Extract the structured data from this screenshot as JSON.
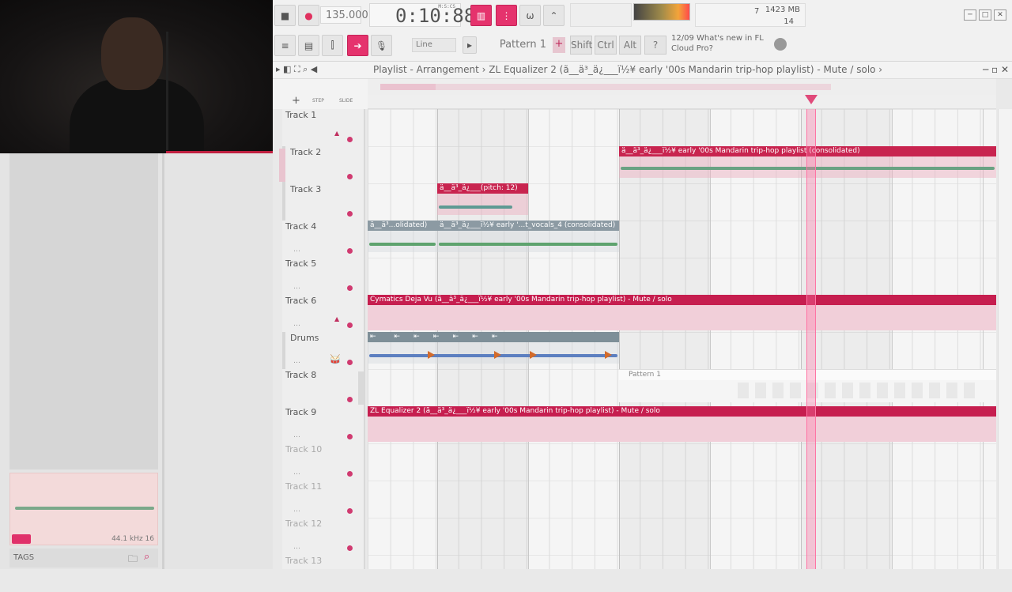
{
  "toolbar": {
    "tempo": "135.000",
    "time": "0:10:88",
    "time_label": "M:S:CS",
    "memory": "1423 MB",
    "cpu_num": "7",
    "voices": "14",
    "line_mode": "Line",
    "pattern": "Pattern 1",
    "pattern_plus": "+",
    "shift": "Shift",
    "ctrl": "Ctrl",
    "alt": "Alt",
    "news_line1": "12/09  What's new in FL",
    "news_line2": "Cloud Pro?"
  },
  "playlist": {
    "title": "Playlist - Arrangement › ZL Equalizer 2 (ã__ä³_ä¿___ï½¥ early '00s Mandarin trip-hop playlist) - Mute / solo ›",
    "step_label": "STEP",
    "slide_label": "SLIDE"
  },
  "tracks": [
    {
      "name": "Track 1"
    },
    {
      "name": "Track 2"
    },
    {
      "name": "Track 3"
    },
    {
      "name": "Track 4"
    },
    {
      "name": "Track 5"
    },
    {
      "name": "Track 6"
    },
    {
      "name": "Drums"
    },
    {
      "name": "Track 8"
    },
    {
      "name": "Track 9"
    },
    {
      "name": "Track 10"
    },
    {
      "name": "Track 11"
    },
    {
      "name": "Track 12"
    },
    {
      "name": "Track 13"
    }
  ],
  "clips": {
    "track2": "ä__ä³_ä¿___ï½¥ early '00s Mandarin trip-hop playlist (consolidated)",
    "track3": "ä__ä³_ä¿___(pitch: 12)",
    "track4a": "ä__ä³...olidated)",
    "track4b": "ä__ä³_ä¿___ï½¥ early '...t_vocals_4 (consolidated)",
    "track6": "Cymatics Deja Vu (ã__ä³_ä¿___ï½¥ early '00s Mandarin trip-hop playlist) - Mute / solo",
    "track8": "Pattern 1",
    "track9": "ZL Equalizer 2 (ã__ä³_ä¿___ï½¥ early '00s Mandarin trip-hop playlist) - Mute / solo"
  },
  "browser": {
    "sample_info": "44.1 kHz 16",
    "tags": "TAGS"
  },
  "colors": {
    "accent": "#e5336d",
    "clip_red": "#c8244f",
    "playhead": "#ff74a4"
  }
}
